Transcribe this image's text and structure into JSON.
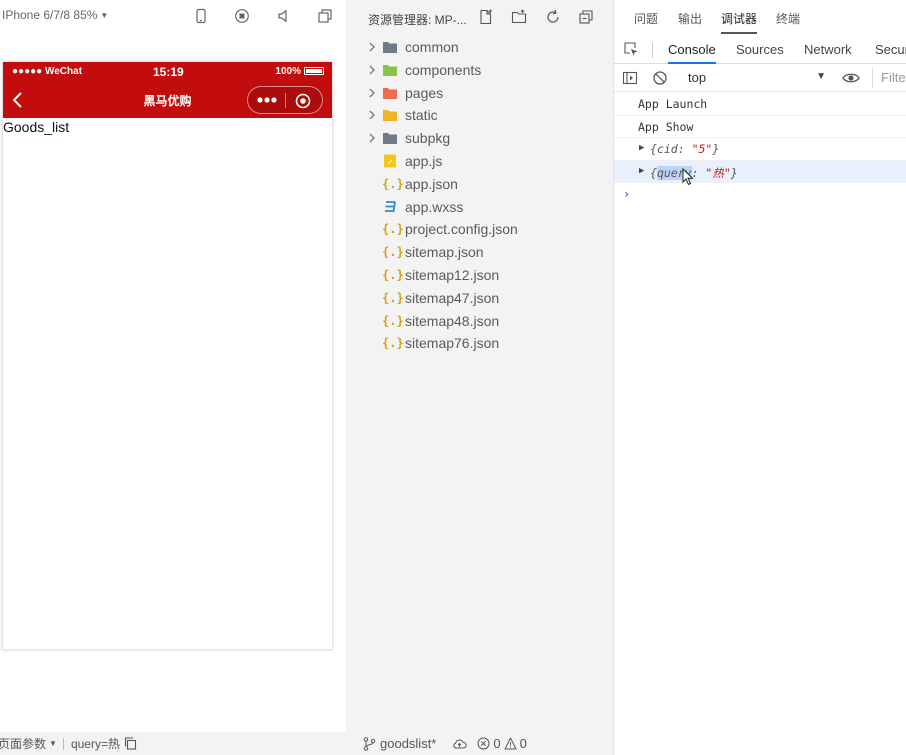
{
  "simulator": {
    "device_label": "IPhone 6/7/8 85%",
    "status_bar": {
      "carrier": "●●●●● WeChat",
      "time": "15:19",
      "battery": "100%"
    },
    "nav_title": "黑马优购",
    "page_text": "Goods_list",
    "footer": {
      "params_label": "页面参数",
      "query_text": "query=热"
    }
  },
  "explorer": {
    "title": "资源管理器: MP-...",
    "items": [
      {
        "label": "common",
        "kind": "folder",
        "icon": "folder-icon",
        "color": "#6f7a8a"
      },
      {
        "label": "components",
        "kind": "folder",
        "icon": "components-folder-icon",
        "color": "#8bc34a"
      },
      {
        "label": "pages",
        "kind": "folder",
        "icon": "pages-folder-icon",
        "color": "#ef6c4d"
      },
      {
        "label": "static",
        "kind": "folder",
        "icon": "static-folder-icon",
        "color": "#f0b429"
      },
      {
        "label": "subpkg",
        "kind": "folder",
        "icon": "folder-icon",
        "color": "#6f7a8a"
      },
      {
        "label": "app.js",
        "kind": "js",
        "icon": "js-file-icon",
        "color": "#f5c518"
      },
      {
        "label": "app.json",
        "kind": "json",
        "icon": "json-file-icon",
        "color": "#d4a017"
      },
      {
        "label": "app.wxss",
        "kind": "css",
        "icon": "css-file-icon",
        "color": "#3a86c8"
      },
      {
        "label": "project.config.json",
        "kind": "json",
        "icon": "json-file-icon",
        "color": "#d4a017"
      },
      {
        "label": "sitemap.json",
        "kind": "json",
        "icon": "json-file-icon",
        "color": "#d4a017"
      },
      {
        "label": "sitemap12.json",
        "kind": "json",
        "icon": "json-file-icon",
        "color": "#d4a017"
      },
      {
        "label": "sitemap47.json",
        "kind": "json",
        "icon": "json-file-icon",
        "color": "#d4a017"
      },
      {
        "label": "sitemap48.json",
        "kind": "json",
        "icon": "json-file-icon",
        "color": "#d4a017"
      },
      {
        "label": "sitemap76.json",
        "kind": "json",
        "icon": "json-file-icon",
        "color": "#d4a017"
      }
    ],
    "footer": {
      "branch": "goodslist*",
      "errors": "0",
      "warnings": "0"
    }
  },
  "debugger": {
    "top_tabs": [
      "问题",
      "输出",
      "调试器",
      "终端"
    ],
    "active_top_tab": "调试器",
    "dev_tabs": [
      "Console",
      "Sources",
      "Network",
      "Securi"
    ],
    "active_dev_tab": "Console",
    "context": "top",
    "filter_placeholder": "Filter",
    "logs": [
      {
        "type": "text",
        "text": "App Launch"
      },
      {
        "type": "text",
        "text": "App Show"
      },
      {
        "type": "object",
        "open": "{",
        "key": "cid",
        "sep": ": ",
        "value": "\"5\"",
        "close": "}"
      },
      {
        "type": "object",
        "open": "{",
        "key": "query",
        "sep": ": ",
        "value": "\"热\"",
        "close": "}"
      }
    ],
    "prompt": "›"
  },
  "colors": {
    "nav_red": "#c30d0d",
    "accent_blue": "#1a73e8",
    "panel_gray": "#f3f3f3"
  }
}
